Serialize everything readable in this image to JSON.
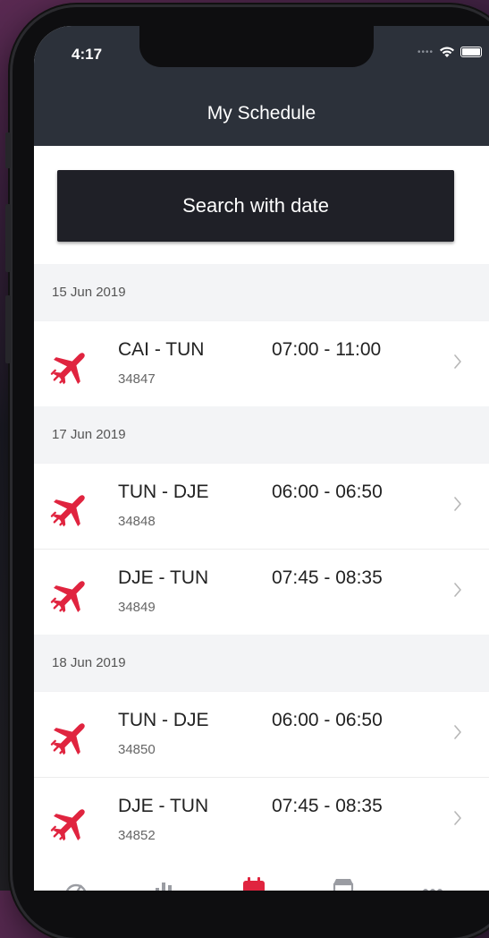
{
  "status": {
    "time": "4:17"
  },
  "header": {
    "title": "My Schedule"
  },
  "search": {
    "label": "Search with date"
  },
  "groups": [
    {
      "date": "15 Jun 2019",
      "flights": [
        {
          "route": "CAI - TUN",
          "code": "34847",
          "time": "07:00 - 11:00"
        }
      ]
    },
    {
      "date": "17 Jun 2019",
      "flights": [
        {
          "route": "TUN - DJE",
          "code": "34848",
          "time": "06:00 - 06:50"
        },
        {
          "route": "DJE - TUN",
          "code": "34849",
          "time": "07:45 - 08:35"
        }
      ]
    },
    {
      "date": "18 Jun 2019",
      "flights": [
        {
          "route": "TUN - DJE",
          "code": "34850",
          "time": "06:00 - 06:50"
        },
        {
          "route": "DJE - TUN",
          "code": "34852",
          "time": "07:45 - 08:35"
        }
      ]
    }
  ],
  "tabs": [
    {
      "icon": "speedometer-icon"
    },
    {
      "icon": "stats-icon"
    },
    {
      "icon": "calendar-icon",
      "active": true
    },
    {
      "icon": "store-icon"
    },
    {
      "icon": "more-icon"
    }
  ],
  "colors": {
    "accent": "#e0243f",
    "header": "#2c313a",
    "button": "#1f2027"
  }
}
